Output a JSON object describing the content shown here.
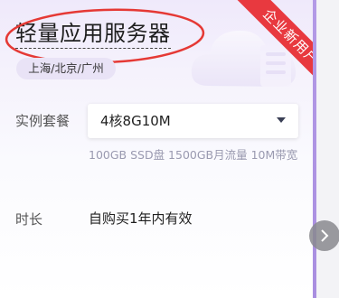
{
  "product": {
    "title": "轻量应用服务器",
    "badge": "企业新用户",
    "regions": "上海/北京/广州"
  },
  "spec": {
    "label": "实例套餐",
    "selected": "4核8G10M",
    "description": "100GB SSD盘 1500GB月流量 10M带宽"
  },
  "duration": {
    "label": "时长",
    "value": "自购买1年内有效"
  },
  "colors": {
    "accent": "#a98ee0",
    "badge_bg": "#e8393f",
    "annotation_circle": "#e53935"
  },
  "icons": {
    "select_arrow": "caret-down-icon",
    "next": "chevron-right-icon",
    "decoration": "cloud-icon"
  }
}
